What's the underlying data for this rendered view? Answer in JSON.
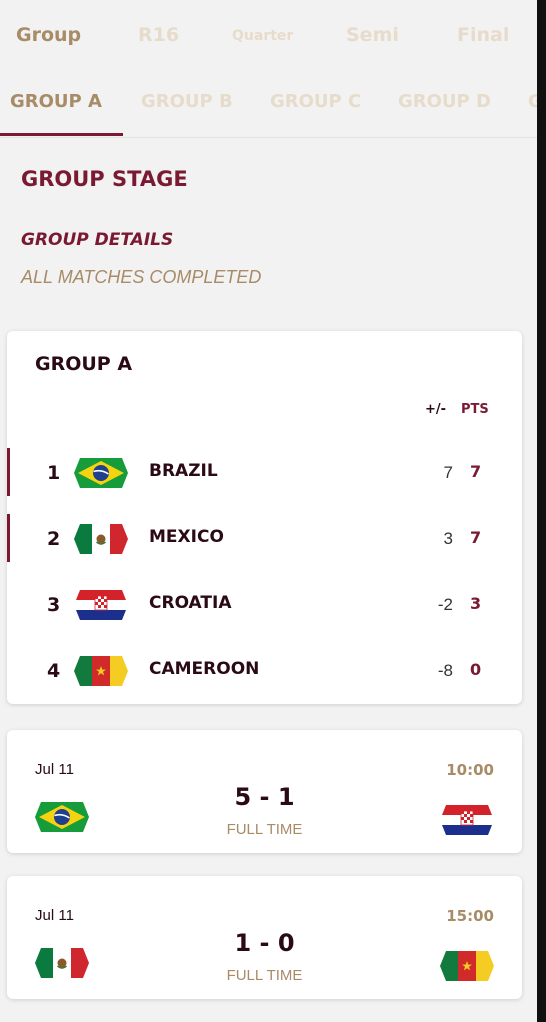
{
  "stage_tabs": [
    {
      "label": "Group",
      "active": true
    },
    {
      "label": "R16",
      "active": false
    },
    {
      "label": "Quarter",
      "active": false
    },
    {
      "label": "Semi",
      "active": false
    },
    {
      "label": "Final",
      "active": false
    }
  ],
  "group_tabs": [
    {
      "label": "GROUP A",
      "active": true
    },
    {
      "label": "GROUP B",
      "active": false
    },
    {
      "label": "GROUP C",
      "active": false
    },
    {
      "label": "GROUP D",
      "active": false
    },
    {
      "label": "G",
      "active": false
    }
  ],
  "section_title": "GROUP STAGE",
  "details": {
    "title": "GROUP DETAILS",
    "status": "ALL MATCHES COMPLETED"
  },
  "group_table": {
    "title": "GROUP A",
    "col_gd": "+/-",
    "col_pts": "PTS",
    "rows": [
      {
        "rank": "1",
        "team": "BRAZIL",
        "flag": "brazil-flag-icon",
        "gd": "7",
        "pts": "7",
        "qualified": true
      },
      {
        "rank": "2",
        "team": "MEXICO",
        "flag": "mexico-flag-icon",
        "gd": "3",
        "pts": "7",
        "qualified": true
      },
      {
        "rank": "3",
        "team": "CROATIA",
        "flag": "croatia-flag-icon",
        "gd": "-2",
        "pts": "3",
        "qualified": false
      },
      {
        "rank": "4",
        "team": "CAMEROON",
        "flag": "cameroon-flag-icon",
        "gd": "-8",
        "pts": "0",
        "qualified": false
      }
    ]
  },
  "matches": [
    {
      "date": "Jul 11",
      "time": "10:00",
      "score": "5 - 1",
      "status": "FULL TIME",
      "home_flag": "brazil-flag-icon",
      "away_flag": "croatia-flag-icon"
    },
    {
      "date": "Jul 11",
      "time": "15:00",
      "score": "1 - 0",
      "status": "FULL TIME",
      "home_flag": "mexico-flag-icon",
      "away_flag": "cameroon-flag-icon"
    }
  ],
  "colors": {
    "accent": "#7a1a32",
    "gold": "#a88b67",
    "inactive_tab": "#e7dccb",
    "background": "#f2f2f2"
  }
}
